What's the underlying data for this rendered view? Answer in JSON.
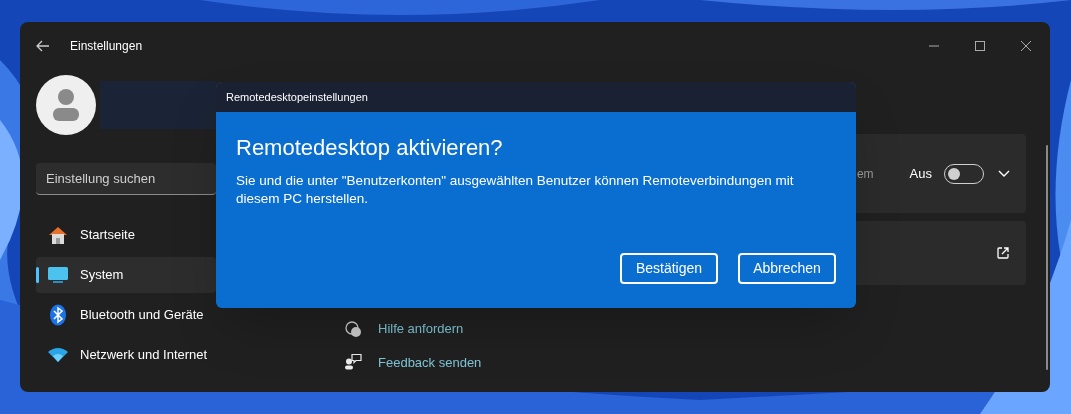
{
  "window": {
    "title": "Einstellungen"
  },
  "search": {
    "placeholder": "Einstellung suchen"
  },
  "nav": [
    {
      "label": "Startseite",
      "selected": false
    },
    {
      "label": "System",
      "selected": true
    },
    {
      "label": "Bluetooth und Geräte",
      "selected": false
    },
    {
      "label": "Netzwerk und Internet",
      "selected": false
    }
  ],
  "cards": [
    {
      "kind": "toggle",
      "text": "em",
      "state_label": "Aus",
      "on": false
    },
    {
      "kind": "link"
    }
  ],
  "help_links": [
    {
      "label": "Hilfe anfordern"
    },
    {
      "label": "Feedback senden"
    }
  ],
  "dialog": {
    "title": "Remotedesktopeinstellungen",
    "heading": "Remotedesktop aktivieren?",
    "message": "Sie und die unter \"Benutzerkonten\" ausgewählten Benutzer können Remoteverbindungen mit diesem PC herstellen.",
    "buttons": [
      "Bestätigen",
      "Abbrechen"
    ]
  }
}
